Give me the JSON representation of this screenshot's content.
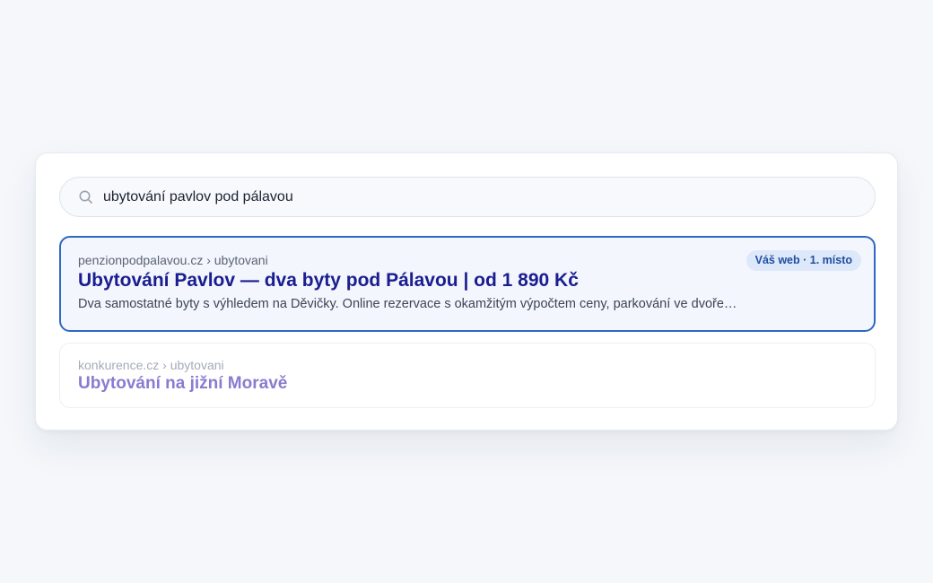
{
  "search": {
    "icon": "search-icon",
    "query": "ubytování pavlov pod pálavou"
  },
  "results": [
    {
      "url": "penzionpodpalavou.cz › ubytovani",
      "title": "Ubytování Pavlov — dva byty pod Pálavou | od 1 890 Kč",
      "snippet": "Dva samostatné byty s výhledem na Děvičky. Online rezervace s okamžitým výpočtem ceny, parkování ve dvoře…",
      "badge": "Váš web · 1. místo",
      "highlighted": true
    },
    {
      "url": "konkurence.cz › ubytovani",
      "title": "Ubytování na jižní Moravě",
      "highlighted": false
    }
  ],
  "colors": {
    "page_background": "#f5f7fb",
    "highlight_border": "#2f67c4",
    "title_link": "#1a1d8f",
    "badge_background": "#dde8fb",
    "badge_text": "#1e4f9e"
  }
}
